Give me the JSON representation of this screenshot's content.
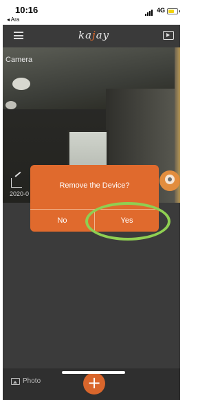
{
  "status_bar": {
    "time": "10:16",
    "back_app": "◂ Ara",
    "network": "4G"
  },
  "header": {
    "logo_text_1": "ka",
    "logo_text_accent": "j",
    "logo_text_2": "ay",
    "menu_icon": "hamburger-icon",
    "cast_icon": "tv-icon"
  },
  "camera": {
    "title": "Camera",
    "date": "2020-0"
  },
  "dialog": {
    "message": "Remove the Device?",
    "no_label": "No",
    "yes_label": "Yes"
  },
  "bottom_bar": {
    "photo_label": "Photo",
    "add_symbol": "+"
  },
  "colors": {
    "accent": "#e06a2d",
    "highlight": "#8fcf52"
  }
}
